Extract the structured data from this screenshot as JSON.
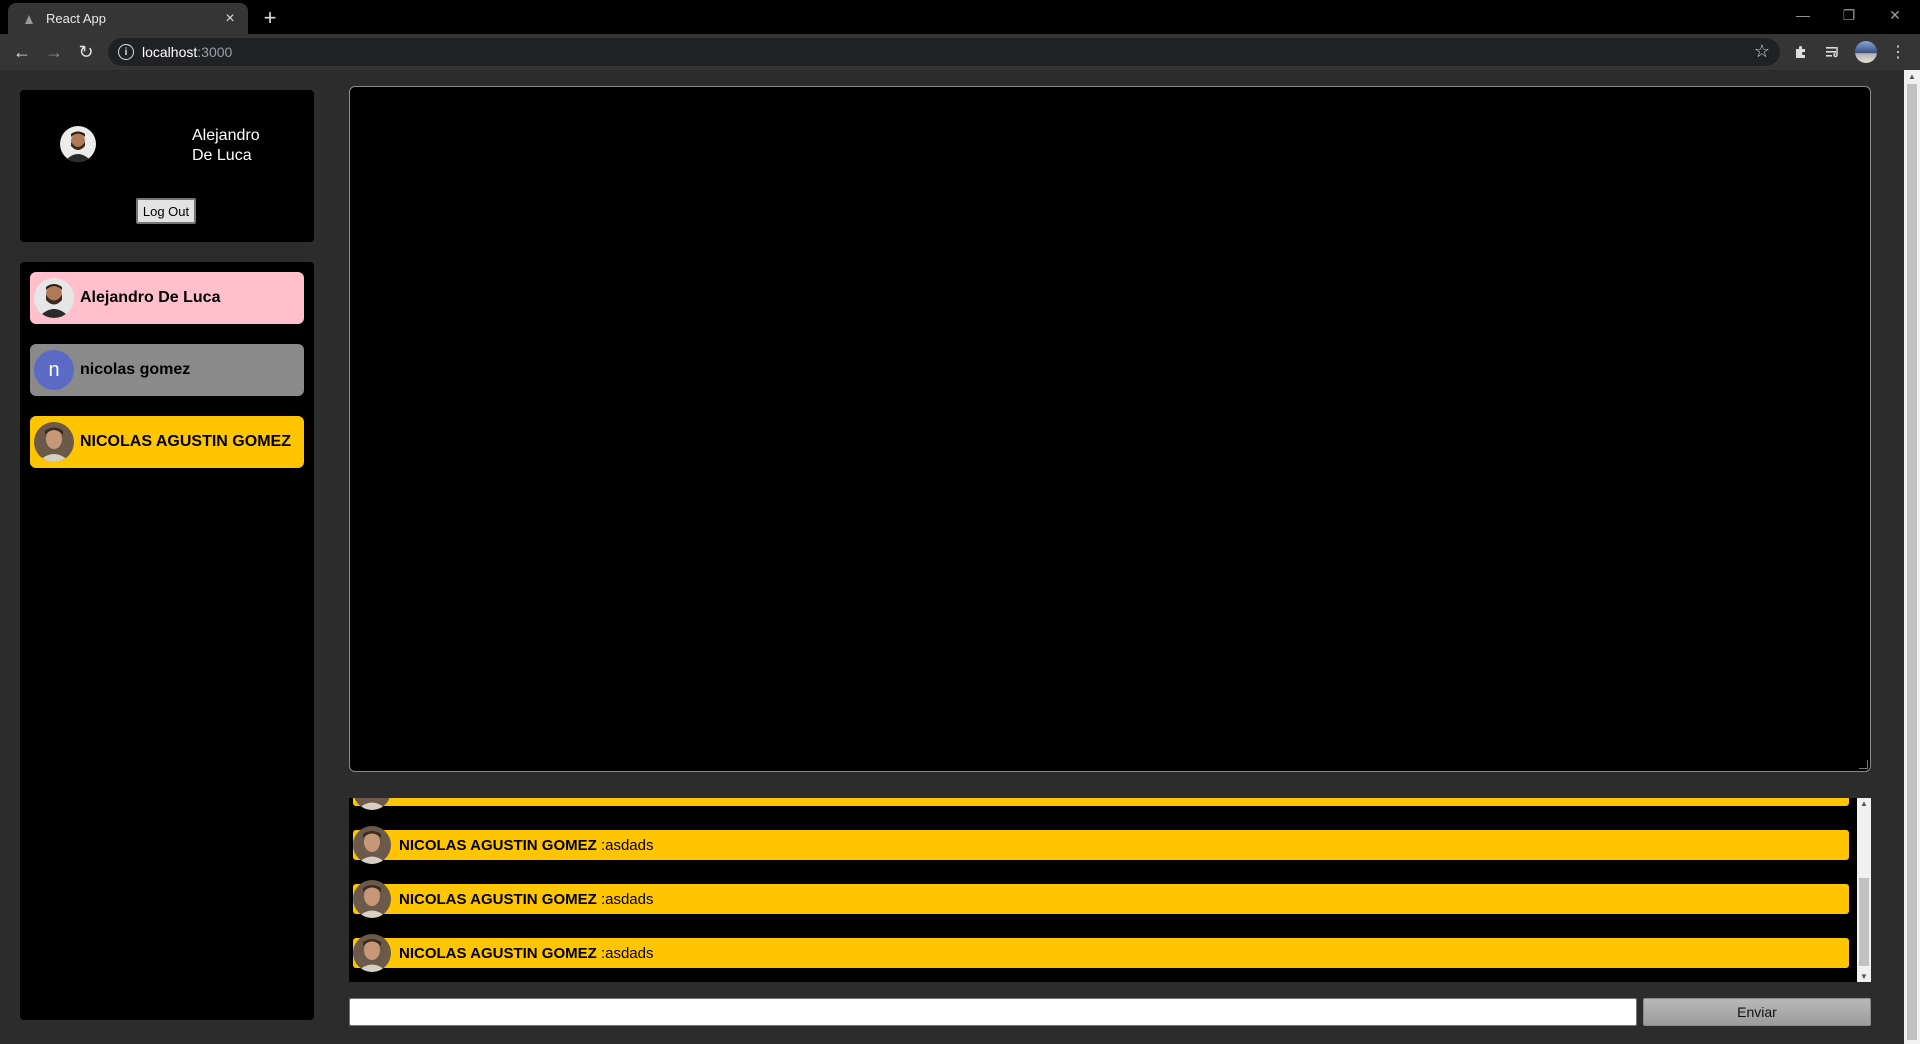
{
  "browser": {
    "tab_title": "React App",
    "tab_close": "×",
    "new_tab": "+",
    "url_host": "localhost",
    "url_port": ":3000",
    "icons": [
      "react-favicon",
      "back-icon",
      "forward-icon",
      "reload-icon",
      "info-icon",
      "star-icon",
      "extensions-icon",
      "reading-list-icon",
      "profile-icon",
      "menu-icon",
      "minimize-icon",
      "restore-icon",
      "close-icon"
    ]
  },
  "user": {
    "first_name": "Alejandro",
    "last_name": "De Luca",
    "logout_label": "Log Out"
  },
  "contacts": [
    {
      "name": "Alejandro De Luca",
      "color": "#ffc0cb",
      "avatar": "photo"
    },
    {
      "name": "nicolas gomez",
      "color": "#8a8a8a",
      "avatar": "letter",
      "letter": "n"
    },
    {
      "name": "NICOLAS AGUSTIN GOMEZ",
      "color": "#ffc600",
      "avatar": "photo"
    }
  ],
  "messages": [
    {
      "author": "NICOLAS AGUSTIN GOMEZ",
      "text": ":asdads"
    },
    {
      "author": "NICOLAS AGUSTIN GOMEZ",
      "text": ":asdads"
    },
    {
      "author": "NICOLAS AGUSTIN GOMEZ",
      "text": ":asdads"
    }
  ],
  "composer": {
    "value": "",
    "send_label": "Enviar"
  },
  "colors": {
    "accent_yellow": "#ffc600",
    "pink": "#ffc0cb",
    "gray": "#8a8a8a",
    "panel": "#000000",
    "page_bg": "#2c2c2c"
  }
}
